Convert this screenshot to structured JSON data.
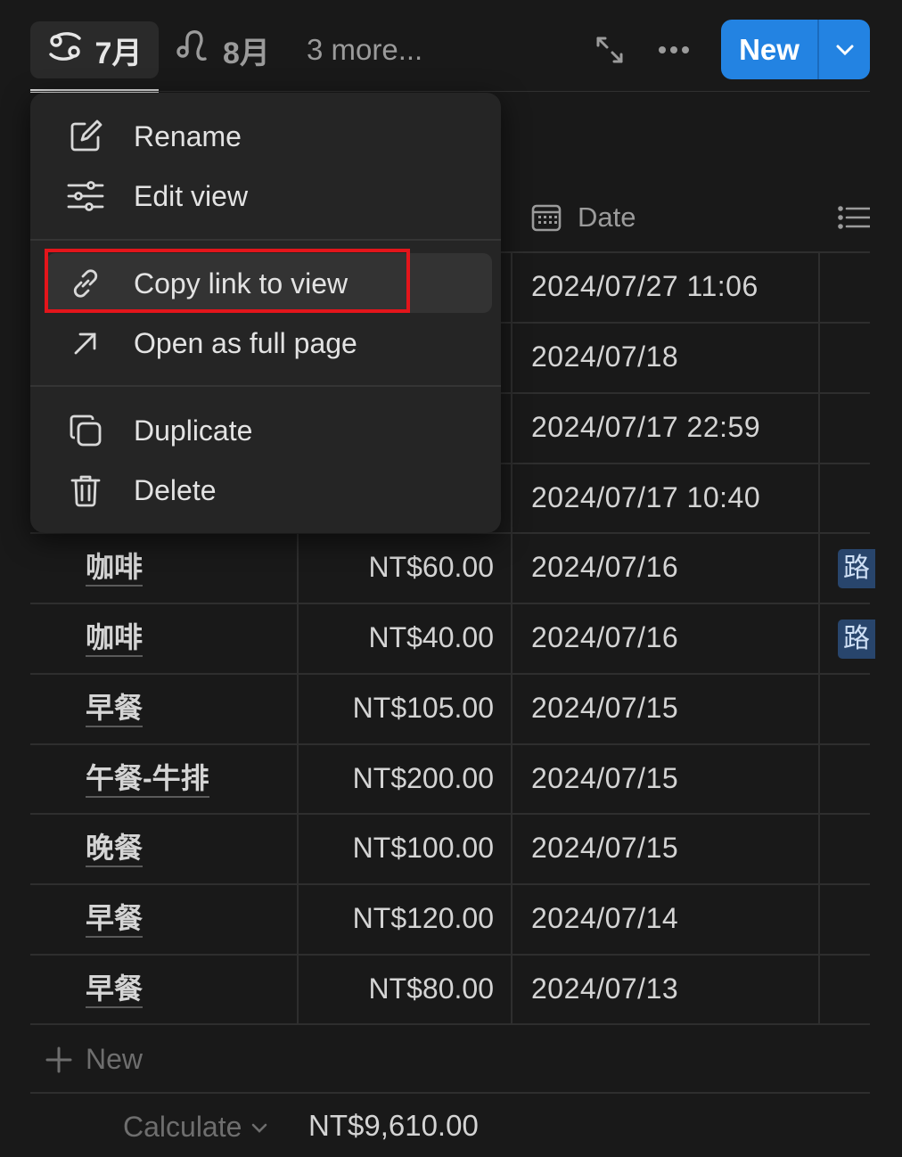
{
  "tabs": {
    "active": {
      "label": "7月",
      "icon": "cancer-zodiac-icon"
    },
    "second": {
      "label": "8月",
      "icon": "leo-zodiac-icon"
    },
    "more": "3 more..."
  },
  "toolbar": {
    "expand_icon": "expand-arrows-icon",
    "more_icon": "ellipsis-icon",
    "new_label": "New",
    "new_dropdown_icon": "chevron-down-icon"
  },
  "table": {
    "date_header": "Date",
    "rows": [
      {
        "name": "",
        "price": "",
        "date": "2024/07/27 11:06",
        "tag": ""
      },
      {
        "name": "",
        "price": "",
        "date": "2024/07/18",
        "tag": ""
      },
      {
        "name": "",
        "price": "",
        "date": "2024/07/17 22:59",
        "tag": ""
      },
      {
        "name": "",
        "price": "",
        "date": "2024/07/17 10:40",
        "tag": ""
      },
      {
        "name": "咖啡",
        "price": "NT$60.00",
        "date": "2024/07/16",
        "tag": "路"
      },
      {
        "name": "咖啡",
        "price": "NT$40.00",
        "date": "2024/07/16",
        "tag": "路"
      },
      {
        "name": "早餐",
        "price": "NT$105.00",
        "date": "2024/07/15",
        "tag": ""
      },
      {
        "name": "午餐-牛排",
        "price": "NT$200.00",
        "date": "2024/07/15",
        "tag": ""
      },
      {
        "name": "晚餐",
        "price": "NT$100.00",
        "date": "2024/07/15",
        "tag": ""
      },
      {
        "name": "早餐",
        "price": "NT$120.00",
        "date": "2024/07/14",
        "tag": ""
      },
      {
        "name": "早餐",
        "price": "NT$80.00",
        "date": "2024/07/13",
        "tag": ""
      }
    ],
    "new_row_label": "New",
    "calculate_label": "Calculate",
    "total": "NT$9,610.00"
  },
  "menu": {
    "rename": "Rename",
    "edit_view": "Edit view",
    "copy_link": "Copy link to view",
    "open_full": "Open as full page",
    "duplicate": "Duplicate",
    "delete": "Delete"
  },
  "colors": {
    "accent": "#2383e2",
    "highlight": "#e3151b",
    "background": "#191919",
    "menu": "#252525"
  }
}
